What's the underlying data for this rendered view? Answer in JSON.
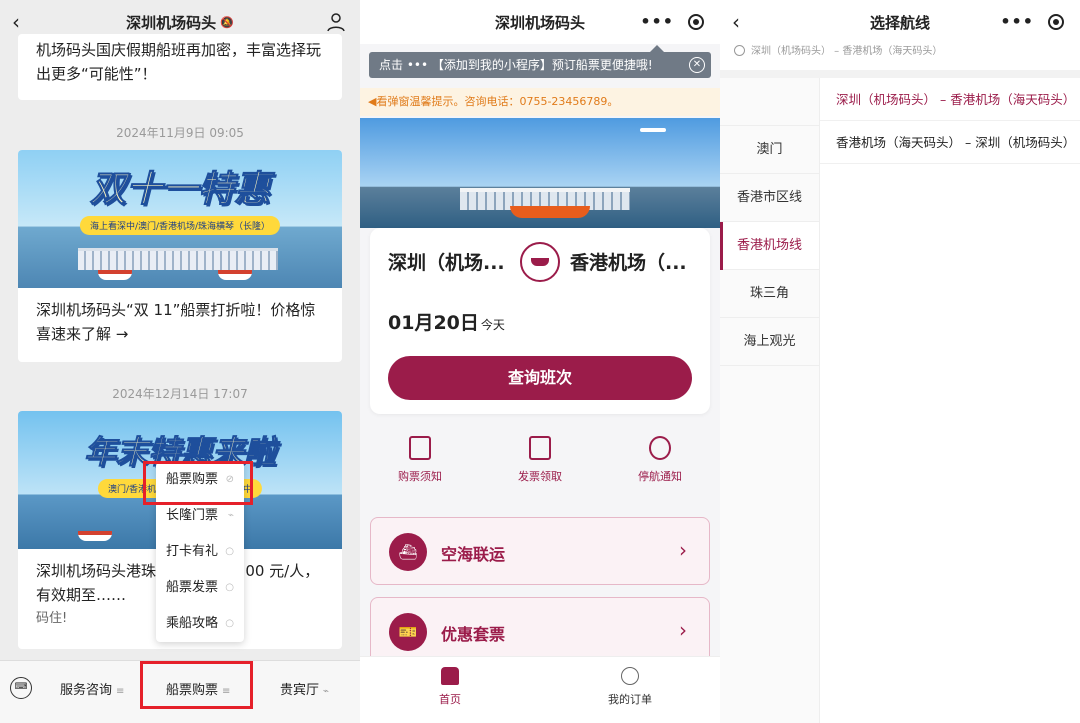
{
  "panel1": {
    "nav": {
      "title": "深圳机场码头"
    },
    "top_card_text": "机场码头国庆假期船班再加密，丰富选择玩出更多“可能性”！",
    "ts1": "2024年11月9日 09:05",
    "card2": {
      "banner_title": "双十一特惠",
      "banner_band": "海上看深中/澳门/香港机场/珠海横琴（长隆）",
      "text": "深圳机场码头“双 11”船票打折啦！价格惊喜速来了解 →"
    },
    "ts2": "2024年12月14日 17:07",
    "card3": {
      "banner_title": "年末特惠来啦",
      "banner_band": "澳门/香港机场/珠海横琴/海上看深中",
      "text": "深圳机场码头港珠澳……低至 100 元/人，有效期至……",
      "sub": "码住!"
    },
    "popup": [
      "船票购票",
      "长隆门票",
      "打卡有礼",
      "船票发票",
      "乘船攻略"
    ],
    "bottom_menu": [
      "服务咨询",
      "船票购票",
      "贵宾厅"
    ]
  },
  "panel2": {
    "nav": {
      "title": "深圳机场码头"
    },
    "tip": "点击 ••• 【添加到我的小程序】预订船票更便捷哦!",
    "notice": "◀看弹窗温馨提示。咨询电话：0755-23456789。",
    "from": "深圳（机场...",
    "to": "香港机场（...",
    "date": "01月20日",
    "date_suffix": "今天",
    "search_label": "查询班次",
    "quick": [
      "购票须知",
      "发票领取",
      "停航通知"
    ],
    "promos": [
      "空海联运",
      "优惠套票"
    ],
    "tabs": [
      "首页",
      "我的订单"
    ],
    "accent": "#9b1c4a"
  },
  "panel3": {
    "nav": {
      "title": "选择航线"
    },
    "history": "深圳（机场码头） – 香港机场（海天码头）",
    "categories": [
      "",
      "澳门",
      "香港市区线",
      "香港机场线",
      "珠三角",
      "海上观光"
    ],
    "active_category": "香港机场线",
    "routes": [
      "深圳（机场码头） – 香港机场（海天码头）",
      "香港机场（海天码头） – 深圳（机场码头）"
    ]
  }
}
